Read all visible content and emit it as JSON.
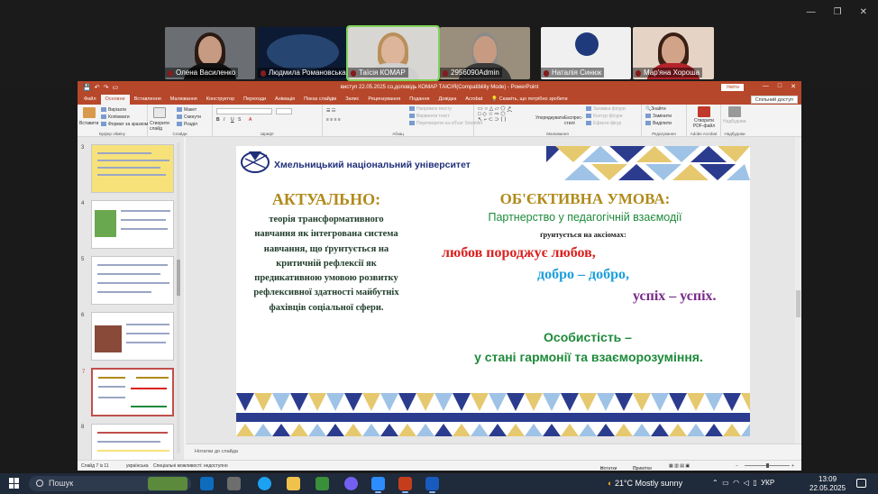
{
  "zoom": {
    "participants": [
      {
        "name": "Олена Василенко",
        "active": false
      },
      {
        "name": "Людмила Романовська",
        "active": false
      },
      {
        "name": "Таїсія КОМАР",
        "active": true
      },
      {
        "name": "2956090Admin",
        "active": false
      },
      {
        "name": "Наталія Синюк",
        "active": false
      },
      {
        "name": "Мар'яна Хороша",
        "active": false
      }
    ]
  },
  "ppt": {
    "title": "виступ 22.05.2025 со,доповідь КОМАР ТАІСІЯ(Compatibility Mode) - PowerPoint",
    "signin": "Увійти",
    "tabs": [
      "Файл",
      "Основне",
      "Вставлення",
      "Малювання",
      "Конструктор",
      "Переходи",
      "Анімація",
      "Показ слайдів",
      "Запис",
      "Рецензування",
      "Подання",
      "Довідка",
      "Acrobat"
    ],
    "tell_me": "Скажіть, що потрібно зробити",
    "share": "Спільний доступ",
    "ribbon": {
      "paste": "Вставити",
      "cut": "Вирізати",
      "copy": "Копіювати",
      "format_painter": "Формат за зразком",
      "clipboard": "Буфер обміну",
      "new_slide": "Створити слайд",
      "layout": "Макет",
      "reset": "Скинути",
      "section": "Розділ",
      "slides": "Слайди",
      "font": "Шрифт",
      "text_dir": "Напрямок тексту",
      "align_text": "Вирівняти текст",
      "smartart": "Перетворити на об'єкт SmartArt",
      "paragraph": "Абзац",
      "arrange": "Упорядкувати",
      "quick_styles": "Експрес-стилі",
      "fill": "Заливка фігури",
      "outline": "Контур фігури",
      "effects": "Ефекти фігур",
      "drawing": "Малювання",
      "find": "Знайти",
      "replace": "Замінити",
      "select": "Виділити",
      "editing": "Редагування",
      "pdf": "Створити PDF-файл",
      "acrobat": "Adobe Acrobat",
      "addins": "Надбудови"
    },
    "thumbnail_numbers": [
      "3",
      "4",
      "5",
      "6",
      "7",
      "8"
    ],
    "selected_slide": "7",
    "notes_placeholder": "Нотатки до слайда",
    "status": {
      "slide": "Слайд 7 із 11",
      "language": "українська",
      "accessibility": "Спеціальні можливості: недоступно",
      "notes": "Нотатки",
      "comments": "Примітки",
      "zoom": "161%"
    }
  },
  "slide": {
    "university": "Хмельницький національний університет",
    "left_title": "АКТУАЛЬНО:",
    "left_text": "теорія трансформативного навчання як інтегрована система навчання, що ґрунтується на критичній рефлексії як предикативною умовою розвитку рефлексивної здатності майбутніх фахівців соціальної сфери.",
    "right_title": "ОБ'ЄКТИВНА УМОВА:",
    "right_subtitle": "Партнерство у педагогічній взаємодії",
    "right_small": "ґрунтується на аксіомах:",
    "axiom1": "любов породжує любов,",
    "axiom2": "добро – добро,",
    "axiom3": "успіх – успіх.",
    "personality1": "Особистість –",
    "personality2": "у стані гармонії та взаєморозуміння."
  },
  "taskbar": {
    "search": "Пошук",
    "weather": "21°C  Mostly sunny",
    "lang": "УКР",
    "time": "13:09",
    "date": "22.05.2025"
  }
}
